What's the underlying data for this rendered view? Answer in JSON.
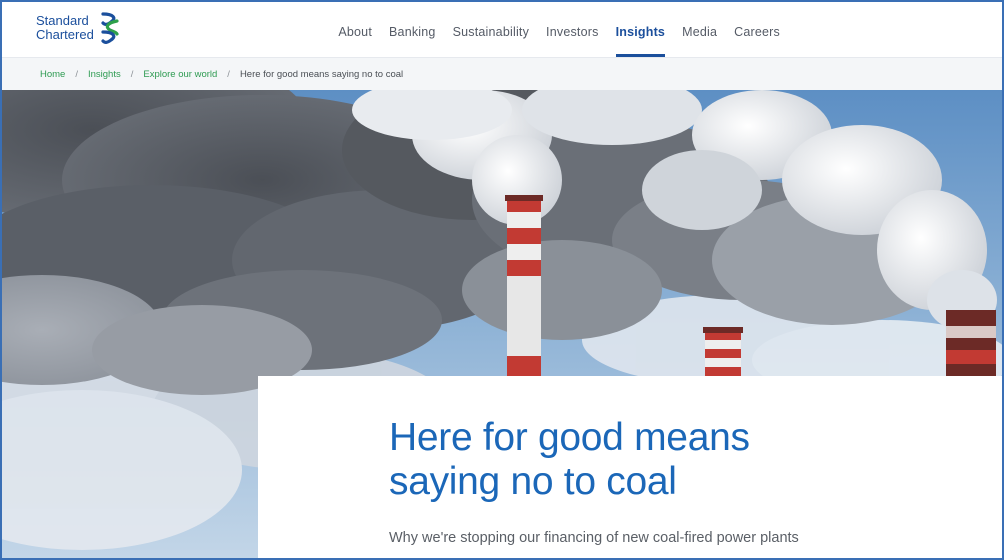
{
  "brand": {
    "line1": "Standard",
    "line2": "Chartered",
    "logo_icon": "standard-chartered-logo-icon",
    "colors": {
      "blue": "#1b4f9c",
      "green": "#2fa04b"
    }
  },
  "nav": {
    "items": [
      {
        "label": "About"
      },
      {
        "label": "Banking"
      },
      {
        "label": "Sustainability"
      },
      {
        "label": "Investors"
      },
      {
        "label": "Insights",
        "active": true
      },
      {
        "label": "Media"
      },
      {
        "label": "Careers"
      }
    ]
  },
  "breadcrumb": {
    "items": [
      "Home",
      "Insights",
      "Explore our world"
    ],
    "separator": "/",
    "current": "Here for good means saying no to coal"
  },
  "article": {
    "title_line1": "Here for good means",
    "title_line2": "saying no to coal",
    "subtitle": "Why we're stopping our financing of new coal-fired power plants"
  },
  "colors": {
    "accent": "#1b4f9c",
    "title": "#1b67b8",
    "breadcrumb_link": "#2e9b52"
  }
}
